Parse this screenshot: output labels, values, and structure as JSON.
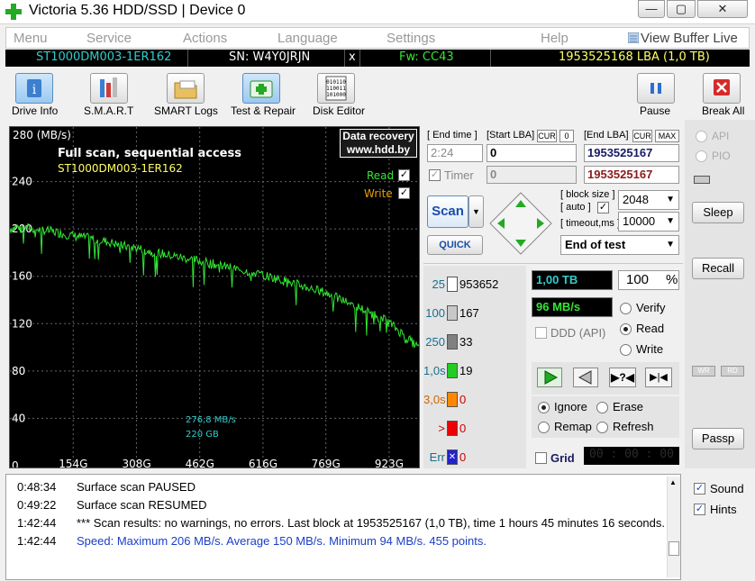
{
  "window": {
    "title": "Victoria 5.36 HDD/SSD | Device 0",
    "btn_minimize": "—",
    "btn_maximize": "▢",
    "btn_close": "✕"
  },
  "menu": {
    "items": [
      "Menu",
      "Service",
      "Actions",
      "Language",
      "Settings",
      "Help"
    ],
    "view_buffer": "View Buffer Live"
  },
  "infobar": {
    "model": "ST1000DM003-1ER162",
    "serial": "SN: W4Y0JRJN",
    "close": "x",
    "firmware": "Fw: CC43",
    "capacity": "1953525168 LBA (1,0 TB)"
  },
  "toolbar": {
    "drive_info": "Drive Info",
    "smart": "S.M.A.R.T",
    "smart_logs": "SMART Logs",
    "test_repair": "Test & Repair",
    "disk_editor": "Disk Editor",
    "pause": "Pause",
    "break_all": "Break All"
  },
  "graph": {
    "ylabel": "280  (MB/s)",
    "yticks": [
      "240",
      "200",
      "160",
      "120",
      "80",
      "40",
      "0"
    ],
    "xticks": [
      "154G",
      "308G",
      "462G",
      "616G",
      "769G",
      "923G"
    ],
    "title": "Full scan, sequential access",
    "subtitle": "ST1000DM003-1ER162",
    "data_recovery_1": "Data recovery",
    "data_recovery_2": "www.hdd.by",
    "legend_read": "Read",
    "legend_write": "Write",
    "cursor_speed": "276,8 MB/s",
    "cursor_pos": "220 GB",
    "colors": {
      "line": "#33e633",
      "title": "#ffffff",
      "subtitle": "#ffff66",
      "read": "#33e633",
      "write": "#e6a000",
      "cursor": "#33cccc"
    }
  },
  "chart_data": {
    "type": "line",
    "title": "Full scan, sequential access",
    "subtitle": "ST1000DM003-1ER162",
    "ylabel": "MB/s",
    "ylim": [
      0,
      280
    ],
    "xlim": [
      0,
      1000
    ],
    "xunit": "GB",
    "series": [
      {
        "name": "Read",
        "x": [
          0,
          20,
          40,
          60,
          80,
          100,
          130,
          154,
          180,
          210,
          240,
          270,
          308,
          340,
          370,
          400,
          430,
          462,
          500,
          540,
          580,
          616,
          650,
          690,
          730,
          769,
          800,
          830,
          860,
          890,
          923,
          950,
          980,
          1000
        ],
        "y": [
          200,
          202,
          201,
          200,
          199,
          198,
          196,
          194,
          193,
          191,
          189,
          186,
          184,
          181,
          179,
          177,
          175,
          173,
          170,
          167,
          164,
          161,
          158,
          154,
          150,
          146,
          141,
          137,
          132,
          127,
          121,
          113,
          104,
          98
        ]
      }
    ]
  },
  "ctrl": {
    "end_time_lbl": "[ End time ]",
    "start_lba_lbl": "[Start LBA]",
    "cur": "CUR",
    "zero": "0",
    "end_lba_lbl": "[End LBA]",
    "cur2": "CUR",
    "max": "MAX",
    "end_time": "2:24",
    "start_lba": "0",
    "end_lba": "1953525167",
    "timer": "Timer",
    "timer_val": "0",
    "end_lba_2": "1953525167",
    "scan": "Scan",
    "quick": "QUICK",
    "block_size_lbl": "[ block size ]",
    "auto_lbl": "[ auto ]",
    "timeout_lbl": "[ timeout,ms ]",
    "block_size": "2048",
    "timeout": "10000",
    "end_of_test": "End of test",
    "stats": [
      {
        "label": "25",
        "count": "953652",
        "color": "#ffffff"
      },
      {
        "label": "100",
        "count": "167",
        "color": "#c8c8c8"
      },
      {
        "label": "250",
        "count": "33",
        "color": "#808080"
      },
      {
        "label": "1,0s",
        "count": "19",
        "color": "#22cc22"
      },
      {
        "label": "3,0s",
        "count": "0",
        "color": "#ff8800"
      },
      {
        "label": ">",
        "count": "0",
        "color": "#ee0000"
      },
      {
        "label": "Err",
        "count": "0",
        "color": "#2222cc"
      }
    ],
    "progress_size": "1,00 TB",
    "progress_pct": "100",
    "pct_sign": "%",
    "speed": "96 MB/s",
    "ddd": "DDD (API)",
    "verify": "Verify",
    "read": "Read",
    "write": "Write",
    "ignore": "Ignore",
    "erase": "Erase",
    "remap": "Remap",
    "refresh": "Refresh",
    "grid": "Grid",
    "grid_time": "00 : 00 : 00"
  },
  "side": {
    "api": "API",
    "pio": "PIO",
    "sleep": "Sleep",
    "recall": "Recall",
    "wr": "WR",
    "rd": "RD",
    "passp": "Passp",
    "sound": "Sound",
    "hints": "Hints"
  },
  "log": [
    {
      "time": "0:48:34",
      "msg": "Surface scan PAUSED",
      "color": "#000000"
    },
    {
      "time": "0:49:22",
      "msg": "Surface scan RESUMED",
      "color": "#000000"
    },
    {
      "time": "1:42:44",
      "msg": "*** Scan results: no warnings, no errors. Last block at 1953525167 (1,0 TB), time 1 hours 45 minutes 16 seconds.",
      "color": "#000000"
    },
    {
      "time": "1:42:44",
      "msg": "Speed: Maximum 206 MB/s. Average 150 MB/s. Minimum 94 MB/s. 455 points.",
      "color": "#1a3ec8"
    }
  ]
}
